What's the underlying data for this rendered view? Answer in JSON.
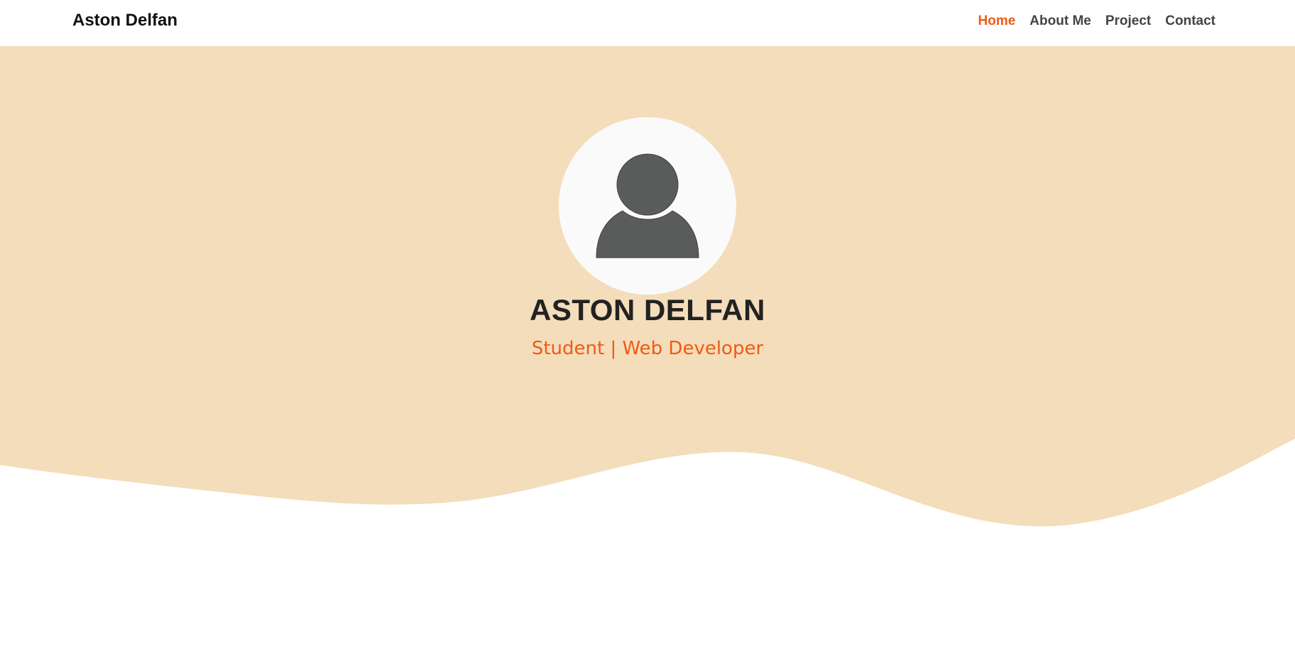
{
  "navbar": {
    "brand": "Aston Delfan",
    "links": [
      {
        "label": "Home",
        "active": true
      },
      {
        "label": "About Me",
        "active": false
      },
      {
        "label": "Project",
        "active": false
      },
      {
        "label": "Contact",
        "active": false
      }
    ]
  },
  "hero": {
    "name": "ASTON DELFAN",
    "subtitle": "Student | Web Developer",
    "avatar_icon": "user-silhouette-icon"
  },
  "colors": {
    "accent": "#f15a13",
    "hero_background": "#f4ddba",
    "nav_text": "#444444",
    "heading_text": "#222222",
    "avatar_background": "#fafafa",
    "avatar_figure": "#5a5c5b"
  }
}
